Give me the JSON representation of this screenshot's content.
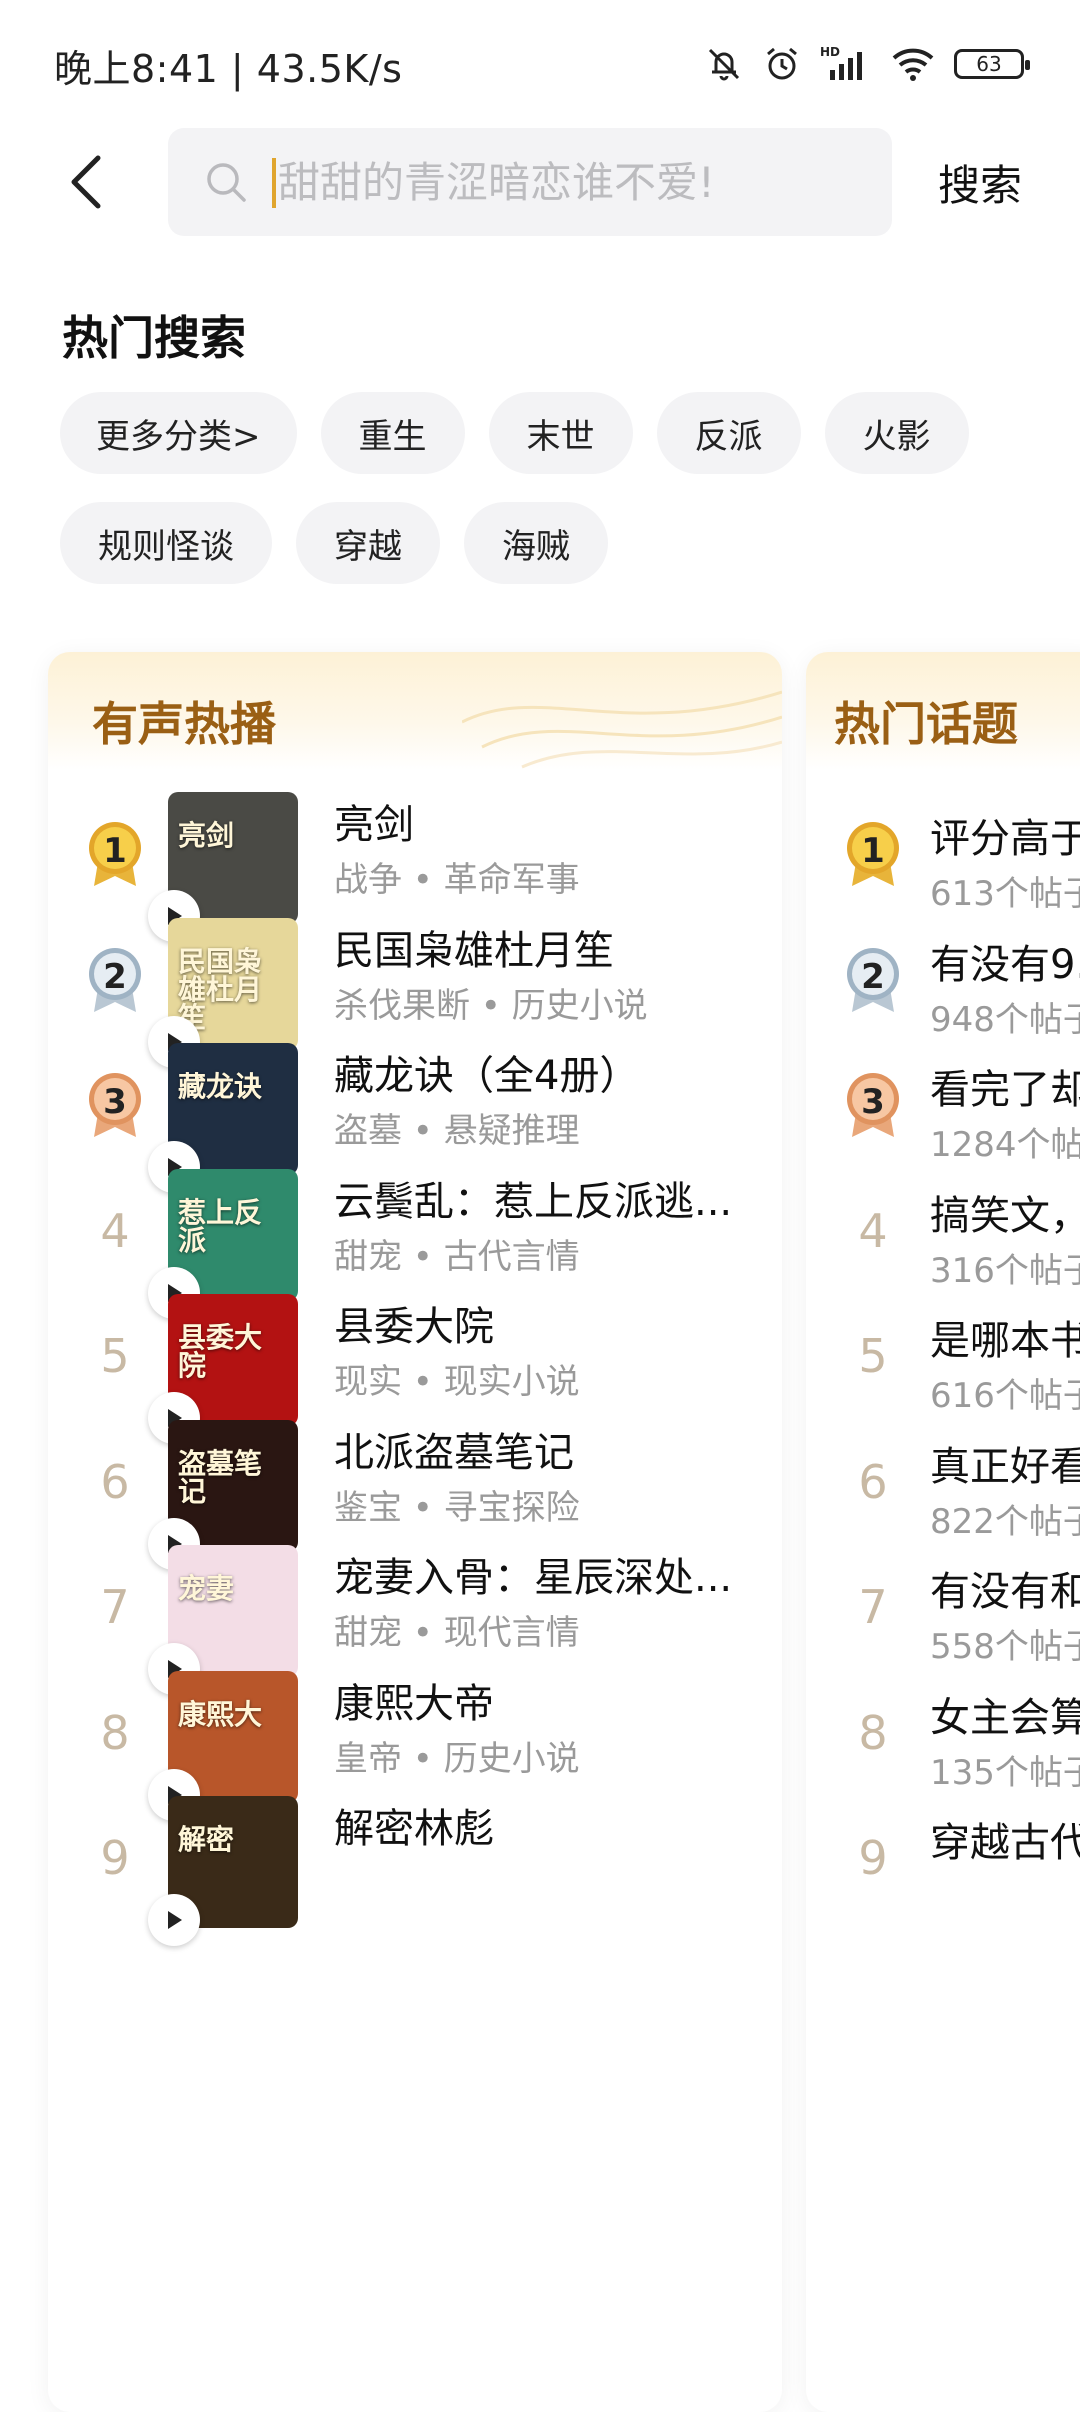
{
  "status_bar": {
    "time_and_speed": "晚上8:41 | 43.5K/s",
    "battery": "63"
  },
  "search": {
    "placeholder": "甜甜的青涩暗恋谁不爱!",
    "button": "搜索"
  },
  "hot_search": {
    "title": "热门搜索",
    "tags": [
      "更多分类>",
      "重生",
      "末世",
      "反派",
      "火影",
      "规则怪谈",
      "穿越",
      "海贼"
    ]
  },
  "audio_hot": {
    "title": "有声热播",
    "items": [
      {
        "rank": "1",
        "title": "亮剑",
        "meta": "战争 • 革命军事",
        "cover_text": "亮剑",
        "cover_bg": "#4a4a45"
      },
      {
        "rank": "2",
        "title": "民国枭雄杜月笙",
        "meta": "杀伐果断 • 历史小说",
        "cover_text": "民国枭雄杜月笙",
        "cover_bg": "#e6d79a"
      },
      {
        "rank": "3",
        "title": "藏龙诀（全4册）",
        "meta": "盗墓 • 悬疑推理",
        "cover_text": "藏龙诀",
        "cover_bg": "#1f2e42"
      },
      {
        "rank": "4",
        "title": "云鬓乱：惹上反派逃...",
        "meta": "甜宠 • 古代言情",
        "cover_text": "惹上反派",
        "cover_bg": "#2f8a6c"
      },
      {
        "rank": "5",
        "title": "县委大院",
        "meta": "现实 • 现实小说",
        "cover_text": "县委大院",
        "cover_bg": "#b31212"
      },
      {
        "rank": "6",
        "title": "北派盗墓笔记",
        "meta": "鉴宝 • 寻宝探险",
        "cover_text": "盗墓笔记",
        "cover_bg": "#2a1612"
      },
      {
        "rank": "7",
        "title": "宠妻入骨：星辰深处...",
        "meta": "甜宠 • 现代言情",
        "cover_text": "宠妻",
        "cover_bg": "#f3dde6"
      },
      {
        "rank": "8",
        "title": "康熙大帝",
        "meta": "皇帝 • 历史小说",
        "cover_text": "康熙大",
        "cover_bg": "#b8562a"
      },
      {
        "rank": "9",
        "title": "解密林彪",
        "meta": "",
        "cover_text": "解密",
        "cover_bg": "#3a2a18"
      }
    ]
  },
  "hot_topics": {
    "title": "热门话题",
    "items": [
      {
        "rank": "1",
        "title": "评分高于",
        "meta": "613个帖子"
      },
      {
        "rank": "2",
        "title": "有没有9.",
        "meta": "948个帖子"
      },
      {
        "rank": "3",
        "title": "看完了却",
        "meta": "1284个帖"
      },
      {
        "rank": "4",
        "title": "搞笑文，",
        "meta": "316个帖子"
      },
      {
        "rank": "5",
        "title": "是哪本书",
        "meta": "616个帖子"
      },
      {
        "rank": "6",
        "title": "真正好看",
        "meta": "822个帖子"
      },
      {
        "rank": "7",
        "title": "有没有和",
        "meta": "558个帖子"
      },
      {
        "rank": "8",
        "title": "女主会算",
        "meta": "135个帖子"
      },
      {
        "rank": "9",
        "title": "穿越古代",
        "meta": ""
      }
    ]
  },
  "colors": {
    "accent": "#e0a52e",
    "card_title": "#9a5f14",
    "rank_plain": "#c8b9a4"
  }
}
